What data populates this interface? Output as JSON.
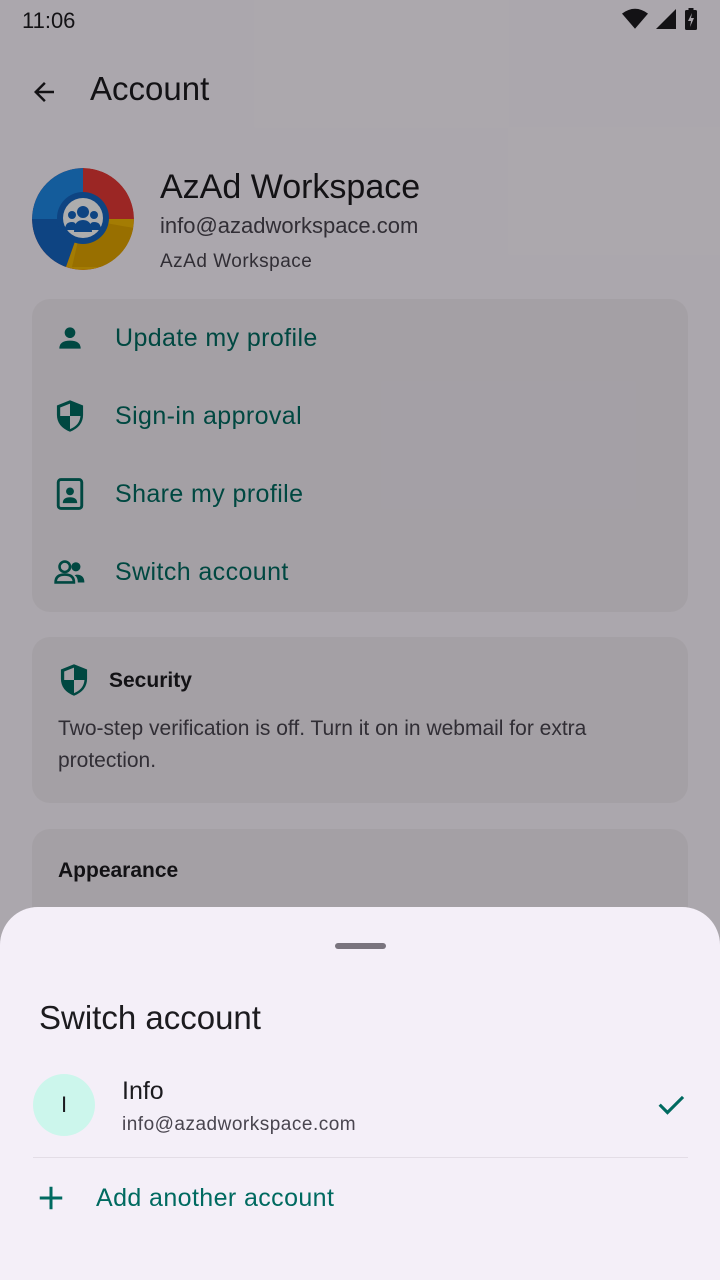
{
  "status_bar": {
    "time": "11:06"
  },
  "app_bar": {
    "title": "Account"
  },
  "profile": {
    "name": "AzAd Workspace",
    "email": "info@azadworkspace.com",
    "organization": "AzAd Workspace"
  },
  "menu": {
    "items": [
      {
        "label": "Update my profile",
        "icon": "person-icon"
      },
      {
        "label": "Sign-in approval",
        "icon": "shield-icon"
      },
      {
        "label": "Share my profile",
        "icon": "contact-card-icon"
      },
      {
        "label": "Switch account",
        "icon": "people-icon"
      }
    ]
  },
  "security": {
    "title": "Security",
    "text": "Two-step verification is off. Turn it on in webmail for extra protection."
  },
  "appearance": {
    "title": "Appearance"
  },
  "sheet": {
    "title": "Switch account",
    "account": {
      "initial": "I",
      "name": "Info",
      "email": "info@azadworkspace.com"
    },
    "add_label": "Add another account"
  },
  "colors": {
    "accent": "#006a60",
    "avatar_bg": "#ccf6ec",
    "sheet_bg": "#f4eff8"
  }
}
